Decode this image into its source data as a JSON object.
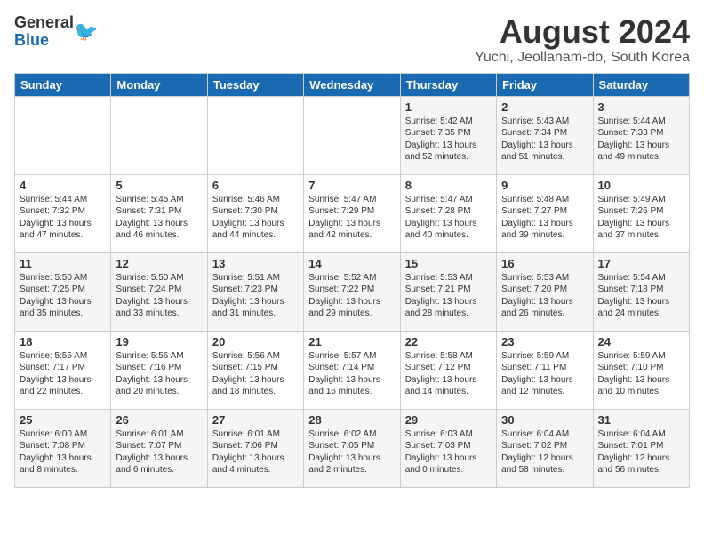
{
  "logo": {
    "general": "General",
    "blue": "Blue"
  },
  "title": {
    "month_year": "August 2024",
    "location": "Yuchi, Jeollanam-do, South Korea"
  },
  "headers": [
    "Sunday",
    "Monday",
    "Tuesday",
    "Wednesday",
    "Thursday",
    "Friday",
    "Saturday"
  ],
  "weeks": [
    [
      {
        "day": "",
        "sunrise": "",
        "sunset": "",
        "daylight": ""
      },
      {
        "day": "",
        "sunrise": "",
        "sunset": "",
        "daylight": ""
      },
      {
        "day": "",
        "sunrise": "",
        "sunset": "",
        "daylight": ""
      },
      {
        "day": "",
        "sunrise": "",
        "sunset": "",
        "daylight": ""
      },
      {
        "day": "1",
        "sunrise": "Sunrise: 5:42 AM",
        "sunset": "Sunset: 7:35 PM",
        "daylight": "Daylight: 13 hours and 52 minutes."
      },
      {
        "day": "2",
        "sunrise": "Sunrise: 5:43 AM",
        "sunset": "Sunset: 7:34 PM",
        "daylight": "Daylight: 13 hours and 51 minutes."
      },
      {
        "day": "3",
        "sunrise": "Sunrise: 5:44 AM",
        "sunset": "Sunset: 7:33 PM",
        "daylight": "Daylight: 13 hours and 49 minutes."
      }
    ],
    [
      {
        "day": "4",
        "sunrise": "Sunrise: 5:44 AM",
        "sunset": "Sunset: 7:32 PM",
        "daylight": "Daylight: 13 hours and 47 minutes."
      },
      {
        "day": "5",
        "sunrise": "Sunrise: 5:45 AM",
        "sunset": "Sunset: 7:31 PM",
        "daylight": "Daylight: 13 hours and 46 minutes."
      },
      {
        "day": "6",
        "sunrise": "Sunrise: 5:46 AM",
        "sunset": "Sunset: 7:30 PM",
        "daylight": "Daylight: 13 hours and 44 minutes."
      },
      {
        "day": "7",
        "sunrise": "Sunrise: 5:47 AM",
        "sunset": "Sunset: 7:29 PM",
        "daylight": "Daylight: 13 hours and 42 minutes."
      },
      {
        "day": "8",
        "sunrise": "Sunrise: 5:47 AM",
        "sunset": "Sunset: 7:28 PM",
        "daylight": "Daylight: 13 hours and 40 minutes."
      },
      {
        "day": "9",
        "sunrise": "Sunrise: 5:48 AM",
        "sunset": "Sunset: 7:27 PM",
        "daylight": "Daylight: 13 hours and 39 minutes."
      },
      {
        "day": "10",
        "sunrise": "Sunrise: 5:49 AM",
        "sunset": "Sunset: 7:26 PM",
        "daylight": "Daylight: 13 hours and 37 minutes."
      }
    ],
    [
      {
        "day": "11",
        "sunrise": "Sunrise: 5:50 AM",
        "sunset": "Sunset: 7:25 PM",
        "daylight": "Daylight: 13 hours and 35 minutes."
      },
      {
        "day": "12",
        "sunrise": "Sunrise: 5:50 AM",
        "sunset": "Sunset: 7:24 PM",
        "daylight": "Daylight: 13 hours and 33 minutes."
      },
      {
        "day": "13",
        "sunrise": "Sunrise: 5:51 AM",
        "sunset": "Sunset: 7:23 PM",
        "daylight": "Daylight: 13 hours and 31 minutes."
      },
      {
        "day": "14",
        "sunrise": "Sunrise: 5:52 AM",
        "sunset": "Sunset: 7:22 PM",
        "daylight": "Daylight: 13 hours and 29 minutes."
      },
      {
        "day": "15",
        "sunrise": "Sunrise: 5:53 AM",
        "sunset": "Sunset: 7:21 PM",
        "daylight": "Daylight: 13 hours and 28 minutes."
      },
      {
        "day": "16",
        "sunrise": "Sunrise: 5:53 AM",
        "sunset": "Sunset: 7:20 PM",
        "daylight": "Daylight: 13 hours and 26 minutes."
      },
      {
        "day": "17",
        "sunrise": "Sunrise: 5:54 AM",
        "sunset": "Sunset: 7:18 PM",
        "daylight": "Daylight: 13 hours and 24 minutes."
      }
    ],
    [
      {
        "day": "18",
        "sunrise": "Sunrise: 5:55 AM",
        "sunset": "Sunset: 7:17 PM",
        "daylight": "Daylight: 13 hours and 22 minutes."
      },
      {
        "day": "19",
        "sunrise": "Sunrise: 5:56 AM",
        "sunset": "Sunset: 7:16 PM",
        "daylight": "Daylight: 13 hours and 20 minutes."
      },
      {
        "day": "20",
        "sunrise": "Sunrise: 5:56 AM",
        "sunset": "Sunset: 7:15 PM",
        "daylight": "Daylight: 13 hours and 18 minutes."
      },
      {
        "day": "21",
        "sunrise": "Sunrise: 5:57 AM",
        "sunset": "Sunset: 7:14 PM",
        "daylight": "Daylight: 13 hours and 16 minutes."
      },
      {
        "day": "22",
        "sunrise": "Sunrise: 5:58 AM",
        "sunset": "Sunset: 7:12 PM",
        "daylight": "Daylight: 13 hours and 14 minutes."
      },
      {
        "day": "23",
        "sunrise": "Sunrise: 5:59 AM",
        "sunset": "Sunset: 7:11 PM",
        "daylight": "Daylight: 13 hours and 12 minutes."
      },
      {
        "day": "24",
        "sunrise": "Sunrise: 5:59 AM",
        "sunset": "Sunset: 7:10 PM",
        "daylight": "Daylight: 13 hours and 10 minutes."
      }
    ],
    [
      {
        "day": "25",
        "sunrise": "Sunrise: 6:00 AM",
        "sunset": "Sunset: 7:08 PM",
        "daylight": "Daylight: 13 hours and 8 minutes."
      },
      {
        "day": "26",
        "sunrise": "Sunrise: 6:01 AM",
        "sunset": "Sunset: 7:07 PM",
        "daylight": "Daylight: 13 hours and 6 minutes."
      },
      {
        "day": "27",
        "sunrise": "Sunrise: 6:01 AM",
        "sunset": "Sunset: 7:06 PM",
        "daylight": "Daylight: 13 hours and 4 minutes."
      },
      {
        "day": "28",
        "sunrise": "Sunrise: 6:02 AM",
        "sunset": "Sunset: 7:05 PM",
        "daylight": "Daylight: 13 hours and 2 minutes."
      },
      {
        "day": "29",
        "sunrise": "Sunrise: 6:03 AM",
        "sunset": "Sunset: 7:03 PM",
        "daylight": "Daylight: 13 hours and 0 minutes."
      },
      {
        "day": "30",
        "sunrise": "Sunrise: 6:04 AM",
        "sunset": "Sunset: 7:02 PM",
        "daylight": "Daylight: 12 hours and 58 minutes."
      },
      {
        "day": "31",
        "sunrise": "Sunrise: 6:04 AM",
        "sunset": "Sunset: 7:01 PM",
        "daylight": "Daylight: 12 hours and 56 minutes."
      }
    ]
  ]
}
